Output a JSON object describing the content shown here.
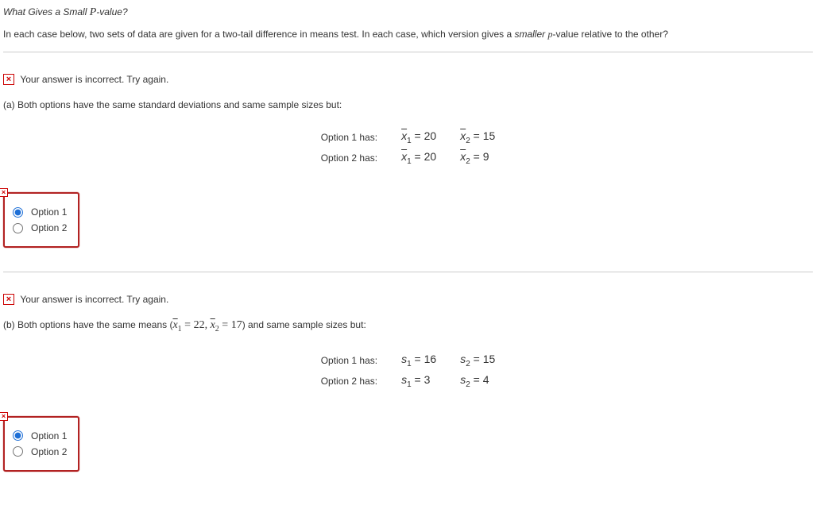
{
  "title_prefix": "What Gives a Small ",
  "title_p": "P",
  "title_suffix": "-value?",
  "intro_prefix": "In each case below, two sets of data are given for a two-tail difference in means test. In each case, which version gives a ",
  "intro_italic": "smaller ",
  "intro_p": "p",
  "intro_suffix": "-value relative to the other?",
  "feedback_text": "Your answer is incorrect.  Try again.",
  "part_a": {
    "prompt": "(a) Both options have the same standard deviations and same sample sizes but:",
    "row1_label": "Option 1 has:",
    "row1_v1": "x̄₁ = 20",
    "row1_v2": "x̄₂ = 15",
    "row2_label": "Option 2 has:",
    "row2_v1": "x̄₁ = 20",
    "row2_v2": "x̄₂ = 9",
    "opt1_label": "Option 1",
    "opt2_label": "Option 2"
  },
  "part_b": {
    "prompt_prefix": "(b) Both options have the same means (",
    "prompt_math": "x̄₁ = 22, x̄₂ = 17",
    "prompt_suffix": ") and same sample sizes but:",
    "row1_label": "Option 1 has:",
    "row1_v1": "s₁ = 16",
    "row1_v2": "s₂ = 15",
    "row2_label": "Option 2 has:",
    "row2_v1": "s₁ = 3",
    "row2_v2": "s₂ = 4",
    "opt1_label": "Option 1",
    "opt2_label": "Option 2"
  }
}
